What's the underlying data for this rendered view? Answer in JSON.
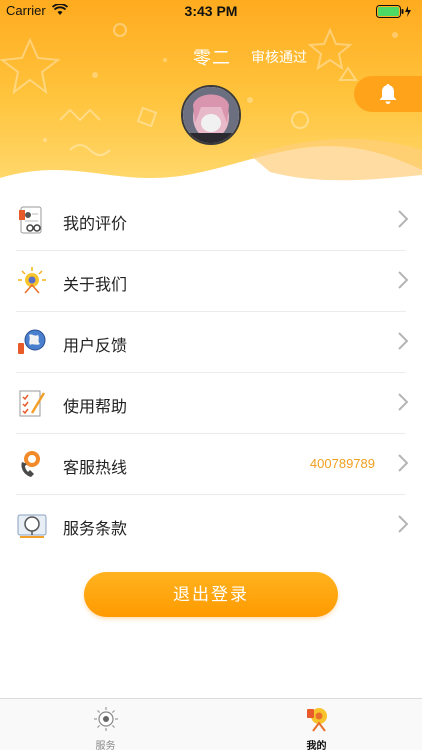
{
  "status_bar": {
    "carrier": "Carrier",
    "time": "3:43 PM"
  },
  "profile": {
    "name": "零二",
    "review_status": "审核通过"
  },
  "menu": [
    {
      "label": "我的评价",
      "icon": "clipboard-review-icon"
    },
    {
      "label": "关于我们",
      "icon": "about-us-icon"
    },
    {
      "label": "用户反馈",
      "icon": "globe-feedback-icon"
    },
    {
      "label": "使用帮助",
      "icon": "checklist-help-icon"
    },
    {
      "label": "客服热线",
      "icon": "phone-hotline-icon",
      "value": "400789789"
    },
    {
      "label": "服务条款",
      "icon": "service-terms-icon"
    }
  ],
  "logout_label": "退出登录",
  "tab_bar": [
    {
      "label": "服务",
      "icon": "service-tab-icon",
      "active": false
    },
    {
      "label": "我的",
      "icon": "mine-tab-icon",
      "active": true
    }
  ],
  "colors": {
    "accent": "#ffa31a",
    "value_text": "#f0a020"
  }
}
